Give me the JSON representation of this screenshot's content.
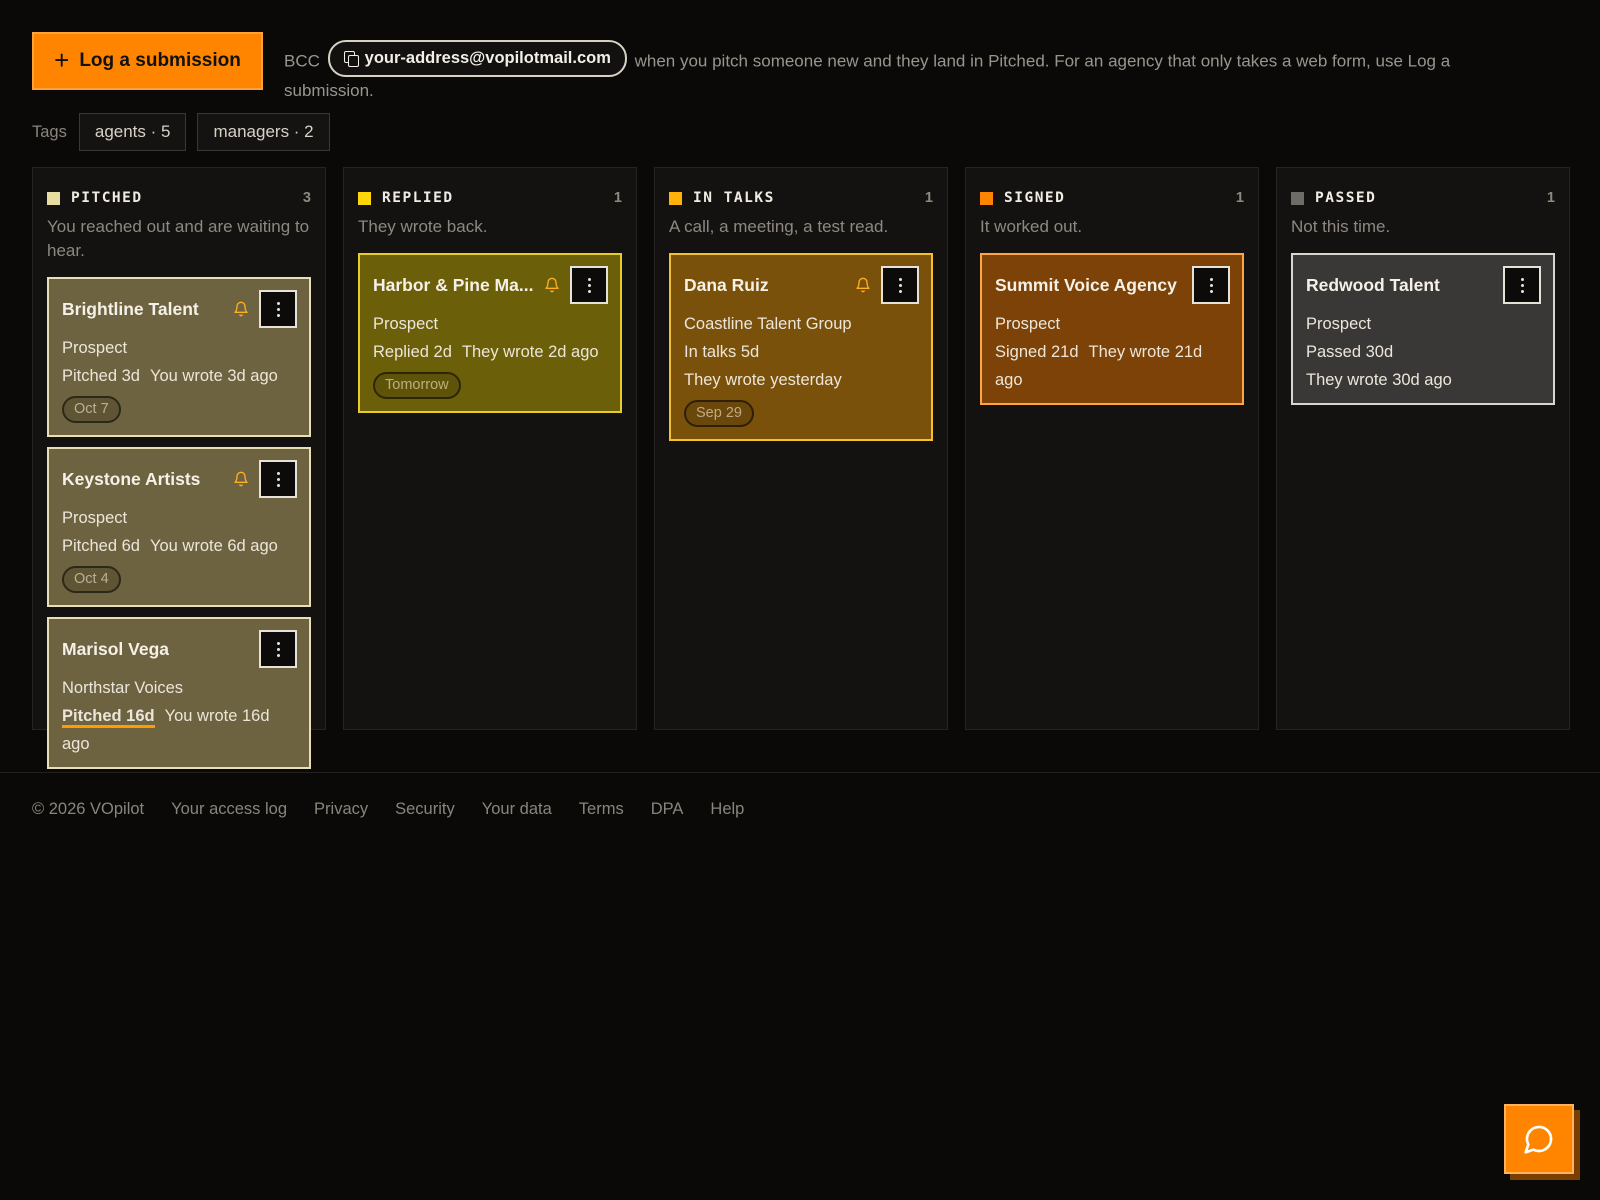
{
  "header": {
    "log_button_label": "Log a submission",
    "bcc_prefix": "BCC",
    "bcc_address": "your-address@vopilotmail.com",
    "bcc_suffix": "when you pitch someone new and they land in Pitched. For an agency that only takes a web form, use Log a submission."
  },
  "tags": {
    "label": "Tags",
    "items": [
      "agents · 5",
      "managers · 2"
    ]
  },
  "columns": [
    {
      "title": "PITCHED",
      "count": "3",
      "color": "#e8dda0",
      "description": "You reached out and are waiting to hear.",
      "cards": [
        {
          "name": "Brightline Talent",
          "line1": "Prospect",
          "status": "Pitched 3d",
          "wrote": "You wrote 3d ago",
          "chip": "Oct 7"
        },
        {
          "name": "Keystone Artists",
          "line1": "Prospect",
          "status": "Pitched 6d",
          "wrote": "You wrote 6d ago",
          "chip": "Oct 4"
        },
        {
          "name": "Marisol Vega",
          "line1": "Northstar Voices",
          "status": "Pitched 16d",
          "wrote": "You wrote 16d ago"
        }
      ]
    },
    {
      "title": "REPLIED",
      "count": "1",
      "color": "#ffd60a",
      "description": "They wrote back.",
      "cards": [
        {
          "name": "Harbor & Pine Ma...",
          "line1": "Prospect",
          "status": "Replied 2d",
          "wrote": "They wrote 2d ago",
          "chip": "Tomorrow"
        }
      ]
    },
    {
      "title": "IN TALKS",
      "count": "1",
      "color": "#ffb20a",
      "description": "A call, a meeting, a test read.",
      "cards": [
        {
          "name": "Dana Ruiz",
          "line1": "Coastline Talent Group",
          "line2": "In talks 5d",
          "line3": "They wrote yesterday",
          "chip": "Sep 29"
        }
      ]
    },
    {
      "title": "SIGNED",
      "count": "1",
      "color": "#ff8400",
      "description": "It worked out.",
      "cards": [
        {
          "name": "Summit Voice Agency",
          "line1": "Prospect",
          "status": "Signed 21d",
          "wrote": "They wrote 21d ago"
        }
      ]
    },
    {
      "title": "PASSED",
      "count": "1",
      "color": "#6f6b66",
      "description": "Not this time.",
      "cards": [
        {
          "name": "Redwood Talent",
          "line1": "Prospect",
          "line2": "Passed 30d",
          "line3": "They wrote 30d ago"
        }
      ]
    }
  ],
  "footer": {
    "copyright": "© 2026 VOpilot",
    "links": [
      "Your access log",
      "Privacy",
      "Security",
      "Your data",
      "Terms",
      "DPA",
      "Help"
    ]
  },
  "icons": {
    "log_button": "plus-icon",
    "bcc": "copy-icon",
    "card_reminder": "bell-icon",
    "card_menu": "more-vertical-icon",
    "chat": "chat-bubble-icon"
  },
  "colors": {
    "accent": "#ff8400",
    "background": "#0a0908",
    "bell": "#ffb020"
  }
}
